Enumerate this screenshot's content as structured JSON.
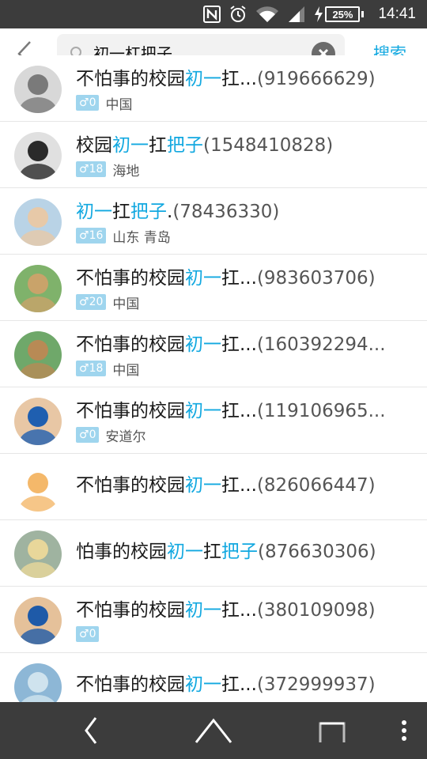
{
  "status_bar": {
    "nfc_icon": "nfc-icon",
    "alarm_icon": "alarm-icon",
    "wifi_icon": "wifi-icon",
    "signal_icon": "signal-icon",
    "charging_icon": "charging-icon",
    "battery": "25%",
    "time": "14:41"
  },
  "search": {
    "back_icon": "back-chevron-icon",
    "query": "初一杠把子",
    "clear_icon": "clear-icon",
    "button_label": "搜索"
  },
  "results": [
    {
      "pre": "不怕事的校园",
      "hl1": "初一",
      "mid": "扛",
      "hl2": "",
      "post": "...",
      "qq": "(919666629)",
      "gender": "♂",
      "age": "0",
      "location": "中国"
    },
    {
      "pre": "校园",
      "hl1": "初一",
      "mid": "扛",
      "hl2": "把子",
      "post": "",
      "qq": "(1548410828)",
      "gender": "♂",
      "age": "18",
      "location": "海地"
    },
    {
      "pre": "",
      "hl1": "初一",
      "mid": "扛",
      "hl2": "把子",
      "post": ".",
      "qq": "(78436330)",
      "gender": "♂",
      "age": "16",
      "location": "山东 青岛"
    },
    {
      "pre": "不怕事的校园",
      "hl1": "初一",
      "mid": "扛",
      "hl2": "",
      "post": "...",
      "qq": "(983603706)",
      "gender": "♂",
      "age": "20",
      "location": "中国"
    },
    {
      "pre": "不怕事的校园",
      "hl1": "初一",
      "mid": "扛",
      "hl2": "",
      "post": "...",
      "qq": "(160392294...",
      "gender": "♂",
      "age": "18",
      "location": "中国"
    },
    {
      "pre": "不怕事的校园",
      "hl1": "初一",
      "mid": "扛",
      "hl2": "",
      "post": "...",
      "qq": "(119106965...",
      "gender": "♂",
      "age": "0",
      "location": "安道尔"
    },
    {
      "pre": "不怕事的校园",
      "hl1": "初一",
      "mid": "扛",
      "hl2": "",
      "post": "...",
      "qq": "(826066447)",
      "gender": "",
      "age": "",
      "location": ""
    },
    {
      "pre": "怕事的校园",
      "hl1": "初一",
      "mid": "扛",
      "hl2": "把子",
      "post": "",
      "qq": "(876630306)",
      "gender": "",
      "age": "",
      "location": ""
    },
    {
      "pre": "不怕事的校园",
      "hl1": "初一",
      "mid": "扛",
      "hl2": "",
      "post": "...",
      "qq": "(380109098)",
      "gender": "♂",
      "age": "0",
      "location": ""
    },
    {
      "pre": "不怕事的校园",
      "hl1": "初一",
      "mid": "扛",
      "hl2": "",
      "post": "...",
      "qq": "(372999937)",
      "gender": "",
      "age": "",
      "location": ""
    }
  ],
  "nav_bar": {
    "back_icon": "nav-back-icon",
    "home_icon": "nav-home-icon",
    "recents_icon": "nav-recents-icon",
    "menu_icon": "nav-menu-icon"
  },
  "colors": {
    "accent": "#12a8e0",
    "badge": "#9fd5ee",
    "bar": "#3c3c3c"
  }
}
